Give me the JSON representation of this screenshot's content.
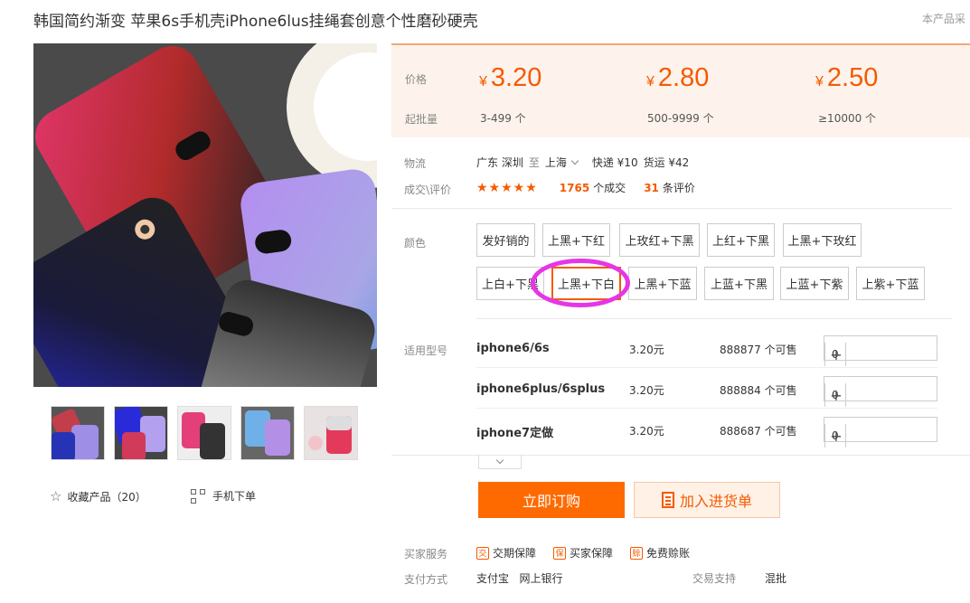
{
  "product": {
    "title": "韩国简约渐变 苹果6s手机壳iPhone6lus挂绳套创意个性磨砂硬壳",
    "title_right": "本产品采"
  },
  "gallery": {
    "favorite_label": "收藏产品（20）",
    "mobile_order_label": "手机下单"
  },
  "pricing": {
    "price_label": "价格",
    "batch_label": "起批量",
    "currency": "¥",
    "tiers": [
      {
        "price": "3.20",
        "qty": "3-499 个"
      },
      {
        "price": "2.80",
        "qty": "500-9999 个"
      },
      {
        "price": "2.50",
        "qty": "≥10000 个"
      }
    ]
  },
  "logistics": {
    "label": "物流",
    "from": "广东 深圳",
    "to_word": "至",
    "to": "上海",
    "express": "快递 ¥10",
    "freight": "货运 ¥42"
  },
  "deals": {
    "label": "成交\\评价",
    "stars": "★★★★★",
    "sold_count": "1765",
    "sold_suffix": "个成交",
    "review_count": "31",
    "review_suffix": "条评价"
  },
  "colors": {
    "label": "颜色",
    "row1": [
      "发好销的",
      "上黑+下红",
      "上玫红+下黑",
      "上红+下黑",
      "上黑+下玫红"
    ],
    "row2": [
      "上白+下黑",
      "上黑+下白",
      "上黑+下蓝",
      "上蓝+下黑",
      "上蓝+下紫",
      "上紫+下蓝"
    ],
    "selected": "上黑+下白"
  },
  "models": {
    "label": "适用型号",
    "rows": [
      {
        "name": "iphone6/6s",
        "price": "3.20元",
        "stock": "888877 个可售",
        "qty": "0"
      },
      {
        "name": "iphone6plus/6splus",
        "price": "3.20元",
        "stock": "888884 个可售",
        "qty": "0"
      },
      {
        "name": "iphone7定做",
        "price": "3.20元",
        "stock": "888687 个可售",
        "qty": "0"
      }
    ]
  },
  "actions": {
    "buy_now": "立即订购",
    "add_to_list": "加入进货单"
  },
  "services": {
    "label": "买家服务",
    "items": [
      "交期保障",
      "买家保障",
      "免费赊账"
    ],
    "icons": [
      "交",
      "保",
      "赊"
    ]
  },
  "payment": {
    "label": "支付方式",
    "methods": "支付宝   网上银行",
    "trade_label": "交易支持",
    "trade_value": "混批"
  },
  "theme": {
    "accent": "#f55a00",
    "highlight": "#e635e6"
  }
}
